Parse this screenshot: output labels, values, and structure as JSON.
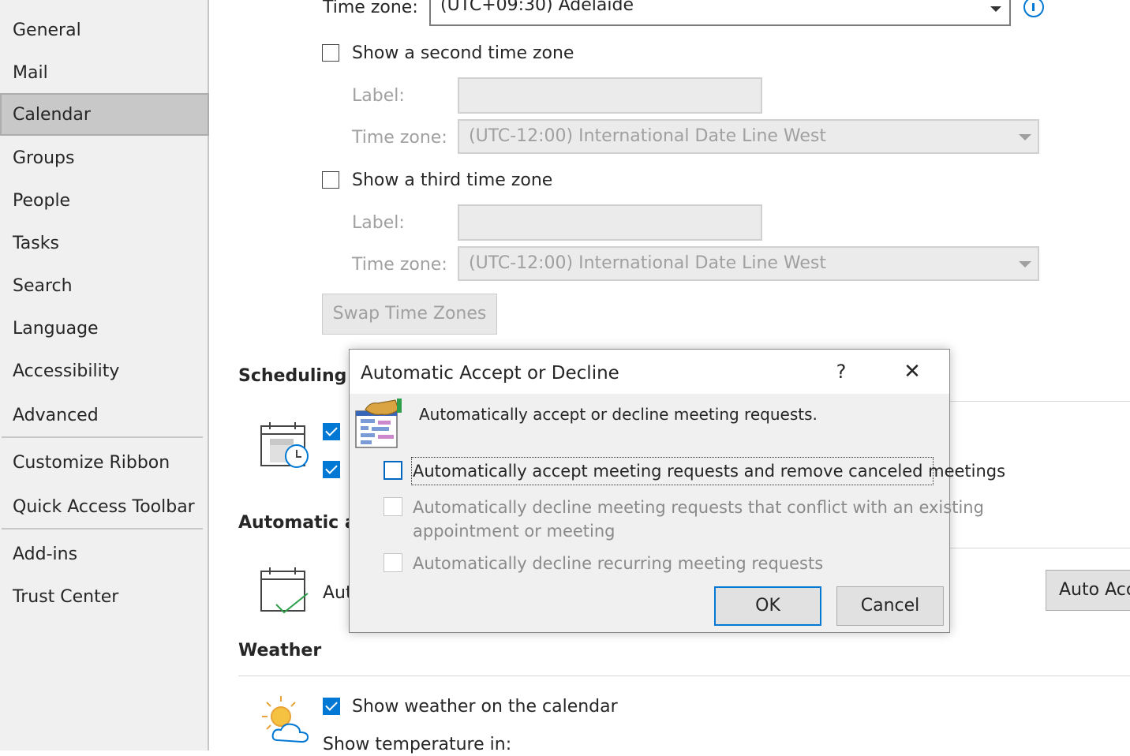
{
  "sidebar": {
    "items": [
      {
        "label": "General"
      },
      {
        "label": "Mail"
      },
      {
        "label": "Calendar"
      },
      {
        "label": "Groups"
      },
      {
        "label": "People"
      },
      {
        "label": "Tasks"
      },
      {
        "label": "Search"
      },
      {
        "label": "Language"
      },
      {
        "label": "Accessibility"
      },
      {
        "label": "Advanced"
      },
      {
        "label": "Customize Ribbon"
      },
      {
        "label": "Quick Access Toolbar"
      },
      {
        "label": "Add-ins"
      },
      {
        "label": "Trust Center"
      }
    ],
    "selected": "Calendar"
  },
  "time_zones": {
    "primary_label": "Time zone:",
    "primary_value": "(UTC+09:30) Adelaide",
    "second": {
      "checkbox_label": "Show a second time zone",
      "checked": false,
      "label_caption": "Label:",
      "label_value": "",
      "tz_caption": "Time zone:",
      "tz_value": "(UTC-12:00) International Date Line West"
    },
    "third": {
      "checkbox_label": "Show a third time zone",
      "checked": false,
      "label_caption": "Label:",
      "label_value": "",
      "tz_caption": "Time zone:",
      "tz_value": "(UTC-12:00) International Date Line West"
    },
    "swap_button": "Swap Time Zones"
  },
  "scheduling": {
    "heading": "Scheduling a"
  },
  "automatic": {
    "heading": "Automatic a",
    "row_text": "Aut",
    "button_label": "Auto Acc"
  },
  "weather": {
    "heading": "Weather",
    "show_label": "Show weather on the calendar",
    "show_checked": true,
    "temperature_label": "Show temperature in:"
  },
  "dialog": {
    "title": "Automatic Accept or Decline",
    "help_label": "?",
    "close_label": "✕",
    "description": "Automatically accept or decline meeting requests.",
    "options": [
      {
        "label": "Automatically accept meeting requests and remove canceled meetings",
        "checked": false,
        "enabled": true
      },
      {
        "label_line1": "Automatically decline meeting requests that conflict with an existing",
        "label_line2": "appointment or meeting",
        "checked": false,
        "enabled": false
      },
      {
        "label": "Automatically decline recurring meeting requests",
        "checked": false,
        "enabled": false
      }
    ],
    "ok_label": "OK",
    "cancel_label": "Cancel"
  },
  "colors": {
    "accent": "#0078d4",
    "sidebar_bg": "#f0f0f0",
    "selected_bg": "#c8c8c8",
    "disabled_text": "#a0a0a0"
  }
}
